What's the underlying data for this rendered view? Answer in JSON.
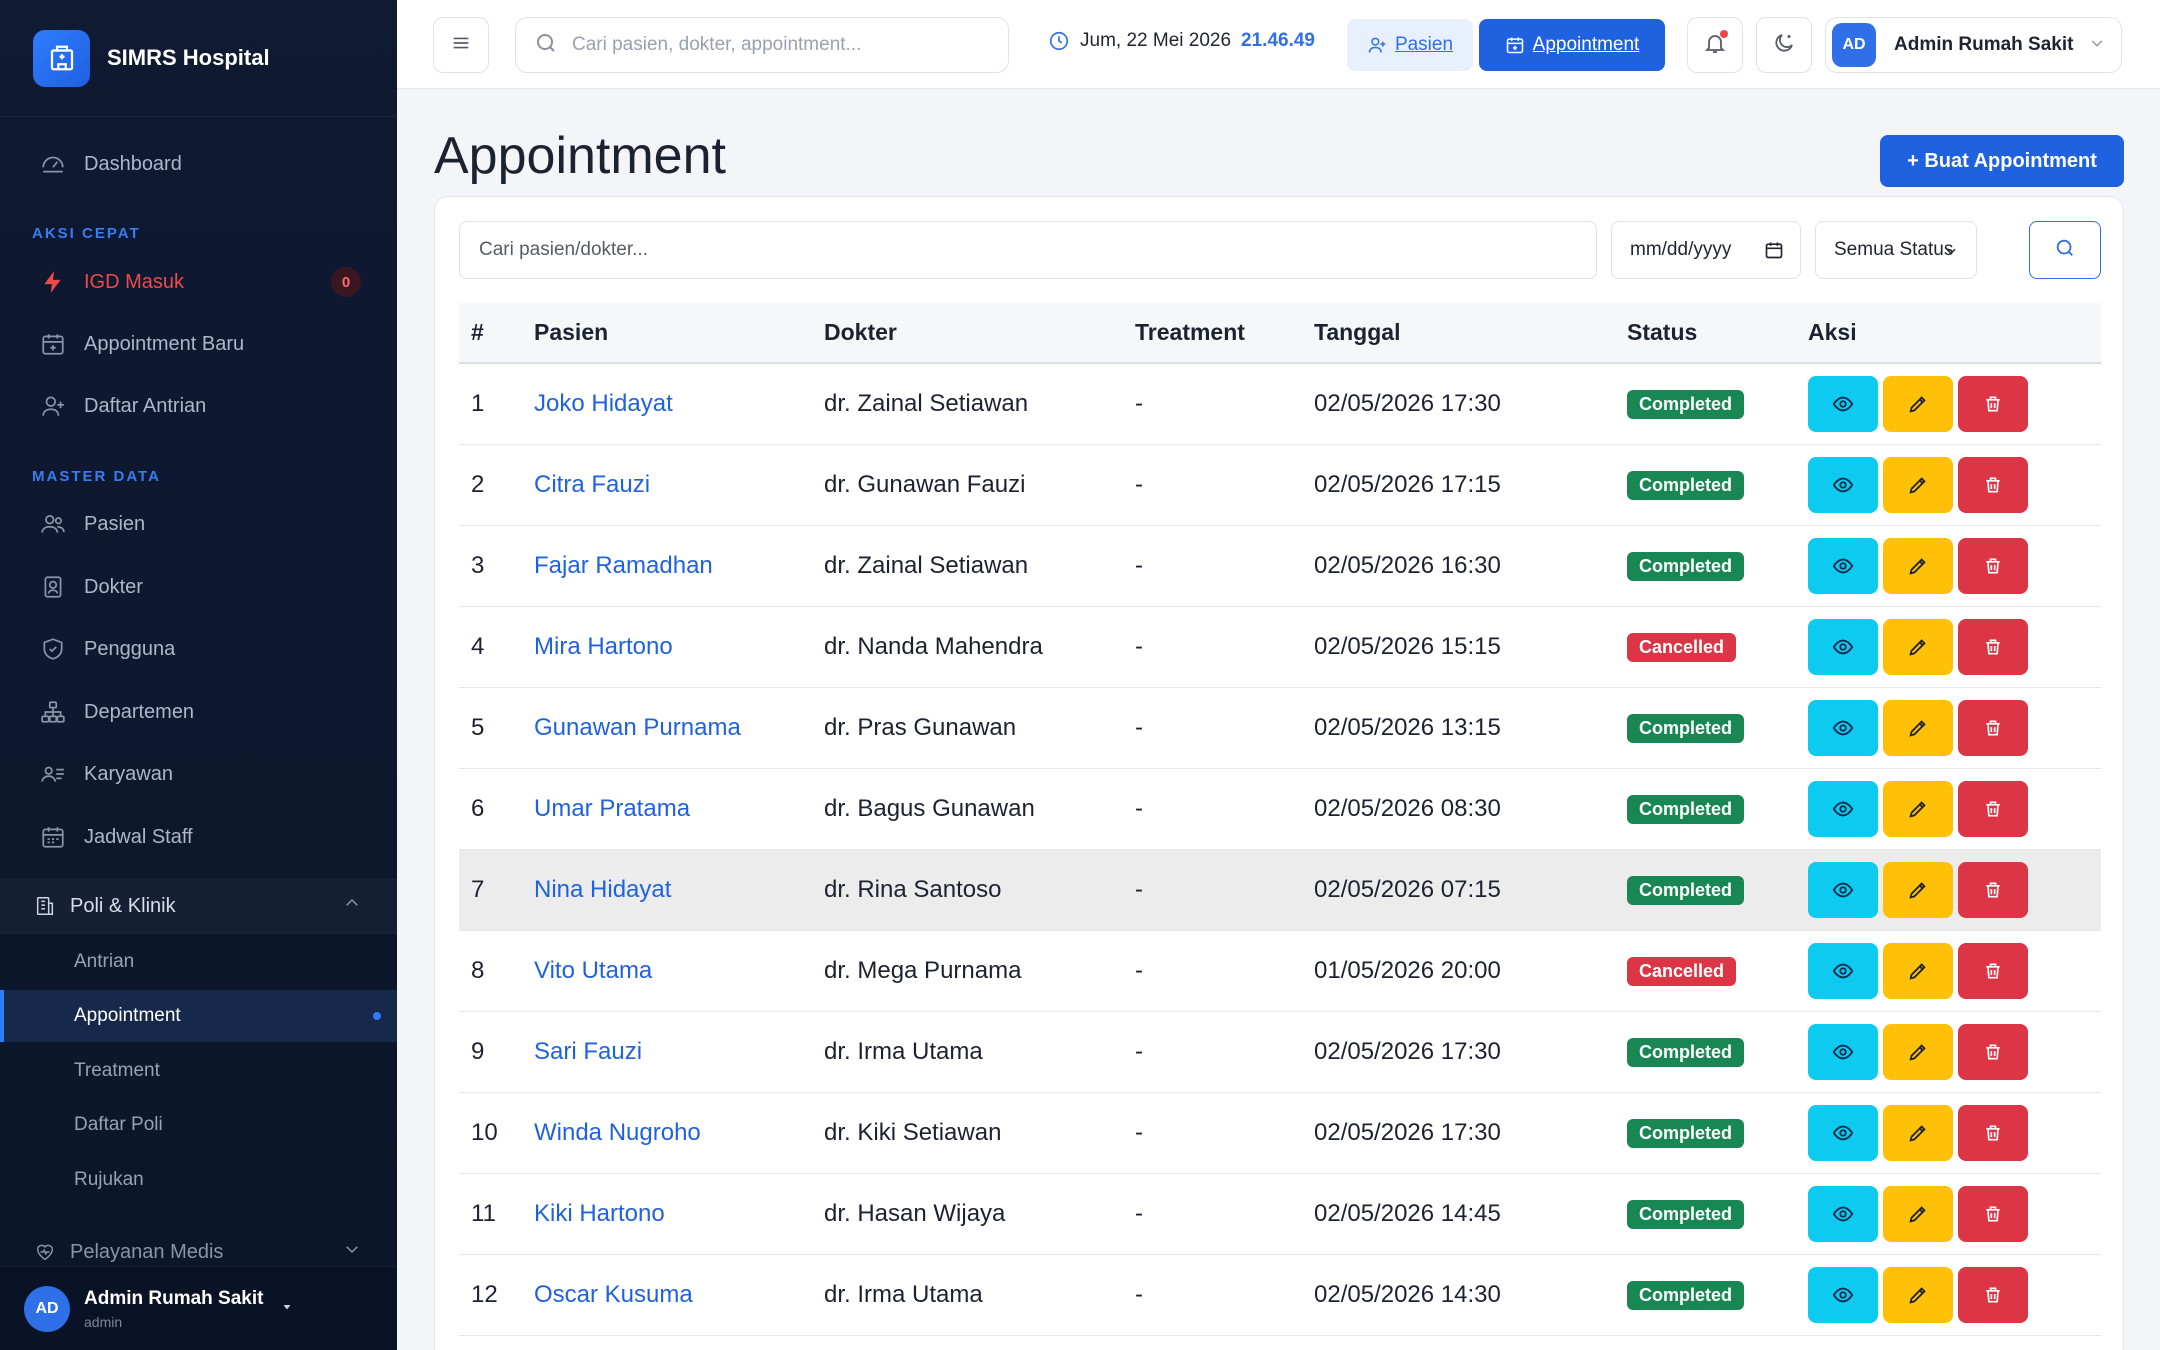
{
  "brand": {
    "name": "SIMRS Hospital"
  },
  "sidebar": {
    "dashboard": "Dashboard",
    "section_quick": "AKSI CEPAT",
    "igd": "IGD Masuk",
    "igd_count": "0",
    "new_appointment": "Appointment Baru",
    "queue_list": "Daftar Antrian",
    "section_master": "MASTER DATA",
    "pasien": "Pasien",
    "dokter": "Dokter",
    "pengguna": "Pengguna",
    "departemen": "Departemen",
    "karyawan": "Karyawan",
    "jadwal": "Jadwal Staff",
    "group_poli": "Poli & Klinik",
    "sub": [
      "Antrian",
      "Appointment",
      "Treatment",
      "Daftar Poli",
      "Rujukan"
    ],
    "group_pelayanan": "Pelayanan Medis",
    "user": {
      "initials": "AD",
      "name": "Admin Rumah Sakit",
      "role": "admin"
    }
  },
  "topbar": {
    "search_placeholder": "Cari pasien, dokter, appointment...",
    "date": "Jum, 22 Mei 2026",
    "time": "21.46.49",
    "pasien_btn": "Pasien",
    "appointment_btn": "Appointment",
    "user": {
      "initials": "AD",
      "name": "Admin Rumah Sakit"
    }
  },
  "page": {
    "title": "Appointment",
    "new_button": "+ Buat Appointment",
    "filter_placeholder": "Cari pasien/dokter...",
    "date_placeholder": "mm/dd/yyyy",
    "status_select": "Semua Status"
  },
  "table": {
    "headers": [
      "#",
      "Pasien",
      "Dokter",
      "Treatment",
      "Tanggal",
      "Status",
      "Aksi"
    ],
    "rows": [
      {
        "no": "1",
        "pasien": "Joko Hidayat",
        "dokter": "dr. Zainal Setiawan",
        "treatment": "-",
        "tanggal": "02/05/2026 17:30",
        "status": "Completed"
      },
      {
        "no": "2",
        "pasien": "Citra Fauzi",
        "dokter": "dr. Gunawan Fauzi",
        "treatment": "-",
        "tanggal": "02/05/2026 17:15",
        "status": "Completed"
      },
      {
        "no": "3",
        "pasien": "Fajar Ramadhan",
        "dokter": "dr. Zainal Setiawan",
        "treatment": "-",
        "tanggal": "02/05/2026 16:30",
        "status": "Completed"
      },
      {
        "no": "4",
        "pasien": "Mira Hartono",
        "dokter": "dr. Nanda Mahendra",
        "treatment": "-",
        "tanggal": "02/05/2026 15:15",
        "status": "Cancelled"
      },
      {
        "no": "5",
        "pasien": "Gunawan Purnama",
        "dokter": "dr. Pras Gunawan",
        "treatment": "-",
        "tanggal": "02/05/2026 13:15",
        "status": "Completed"
      },
      {
        "no": "6",
        "pasien": "Umar Pratama",
        "dokter": "dr. Bagus Gunawan",
        "treatment": "-",
        "tanggal": "02/05/2026 08:30",
        "status": "Completed"
      },
      {
        "no": "7",
        "pasien": "Nina Hidayat",
        "dokter": "dr. Rina Santoso",
        "treatment": "-",
        "tanggal": "02/05/2026 07:15",
        "status": "Completed"
      },
      {
        "no": "8",
        "pasien": "Vito Utama",
        "dokter": "dr. Mega Purnama",
        "treatment": "-",
        "tanggal": "01/05/2026 20:00",
        "status": "Cancelled"
      },
      {
        "no": "9",
        "pasien": "Sari Fauzi",
        "dokter": "dr. Irma Utama",
        "treatment": "-",
        "tanggal": "02/05/2026 17:30",
        "status": "Completed"
      },
      {
        "no": "10",
        "pasien": "Winda Nugroho",
        "dokter": "dr. Kiki Setiawan",
        "treatment": "-",
        "tanggal": "02/05/2026 17:30",
        "status": "Completed"
      },
      {
        "no": "11",
        "pasien": "Kiki Hartono",
        "dokter": "dr. Hasan Wijaya",
        "treatment": "-",
        "tanggal": "02/05/2026 14:45",
        "status": "Completed"
      },
      {
        "no": "12",
        "pasien": "Oscar Kusuma",
        "dokter": "dr. Irma Utama",
        "treatment": "-",
        "tanggal": "02/05/2026 14:30",
        "status": "Completed"
      }
    ]
  },
  "colors": {
    "primary": "#1f62e0",
    "sidebar_bg": "#0f1a33",
    "completed": "#198754",
    "cancelled": "#dc3545",
    "view": "#0dcaf0",
    "edit": "#ffc107"
  },
  "icons": [
    "hospital-icon",
    "dashboard-icon",
    "lightning-icon",
    "calendar-plus-icon",
    "user-plus-icon",
    "users-icon",
    "doctor-icon",
    "shield-icon",
    "sitemap-icon",
    "id-card-icon",
    "calendar-icon",
    "building-icon",
    "heart-icon",
    "menu-icon",
    "search-icon",
    "clock-icon",
    "bell-icon",
    "moon-icon",
    "eye-icon",
    "pencil-icon",
    "trash-icon"
  ]
}
